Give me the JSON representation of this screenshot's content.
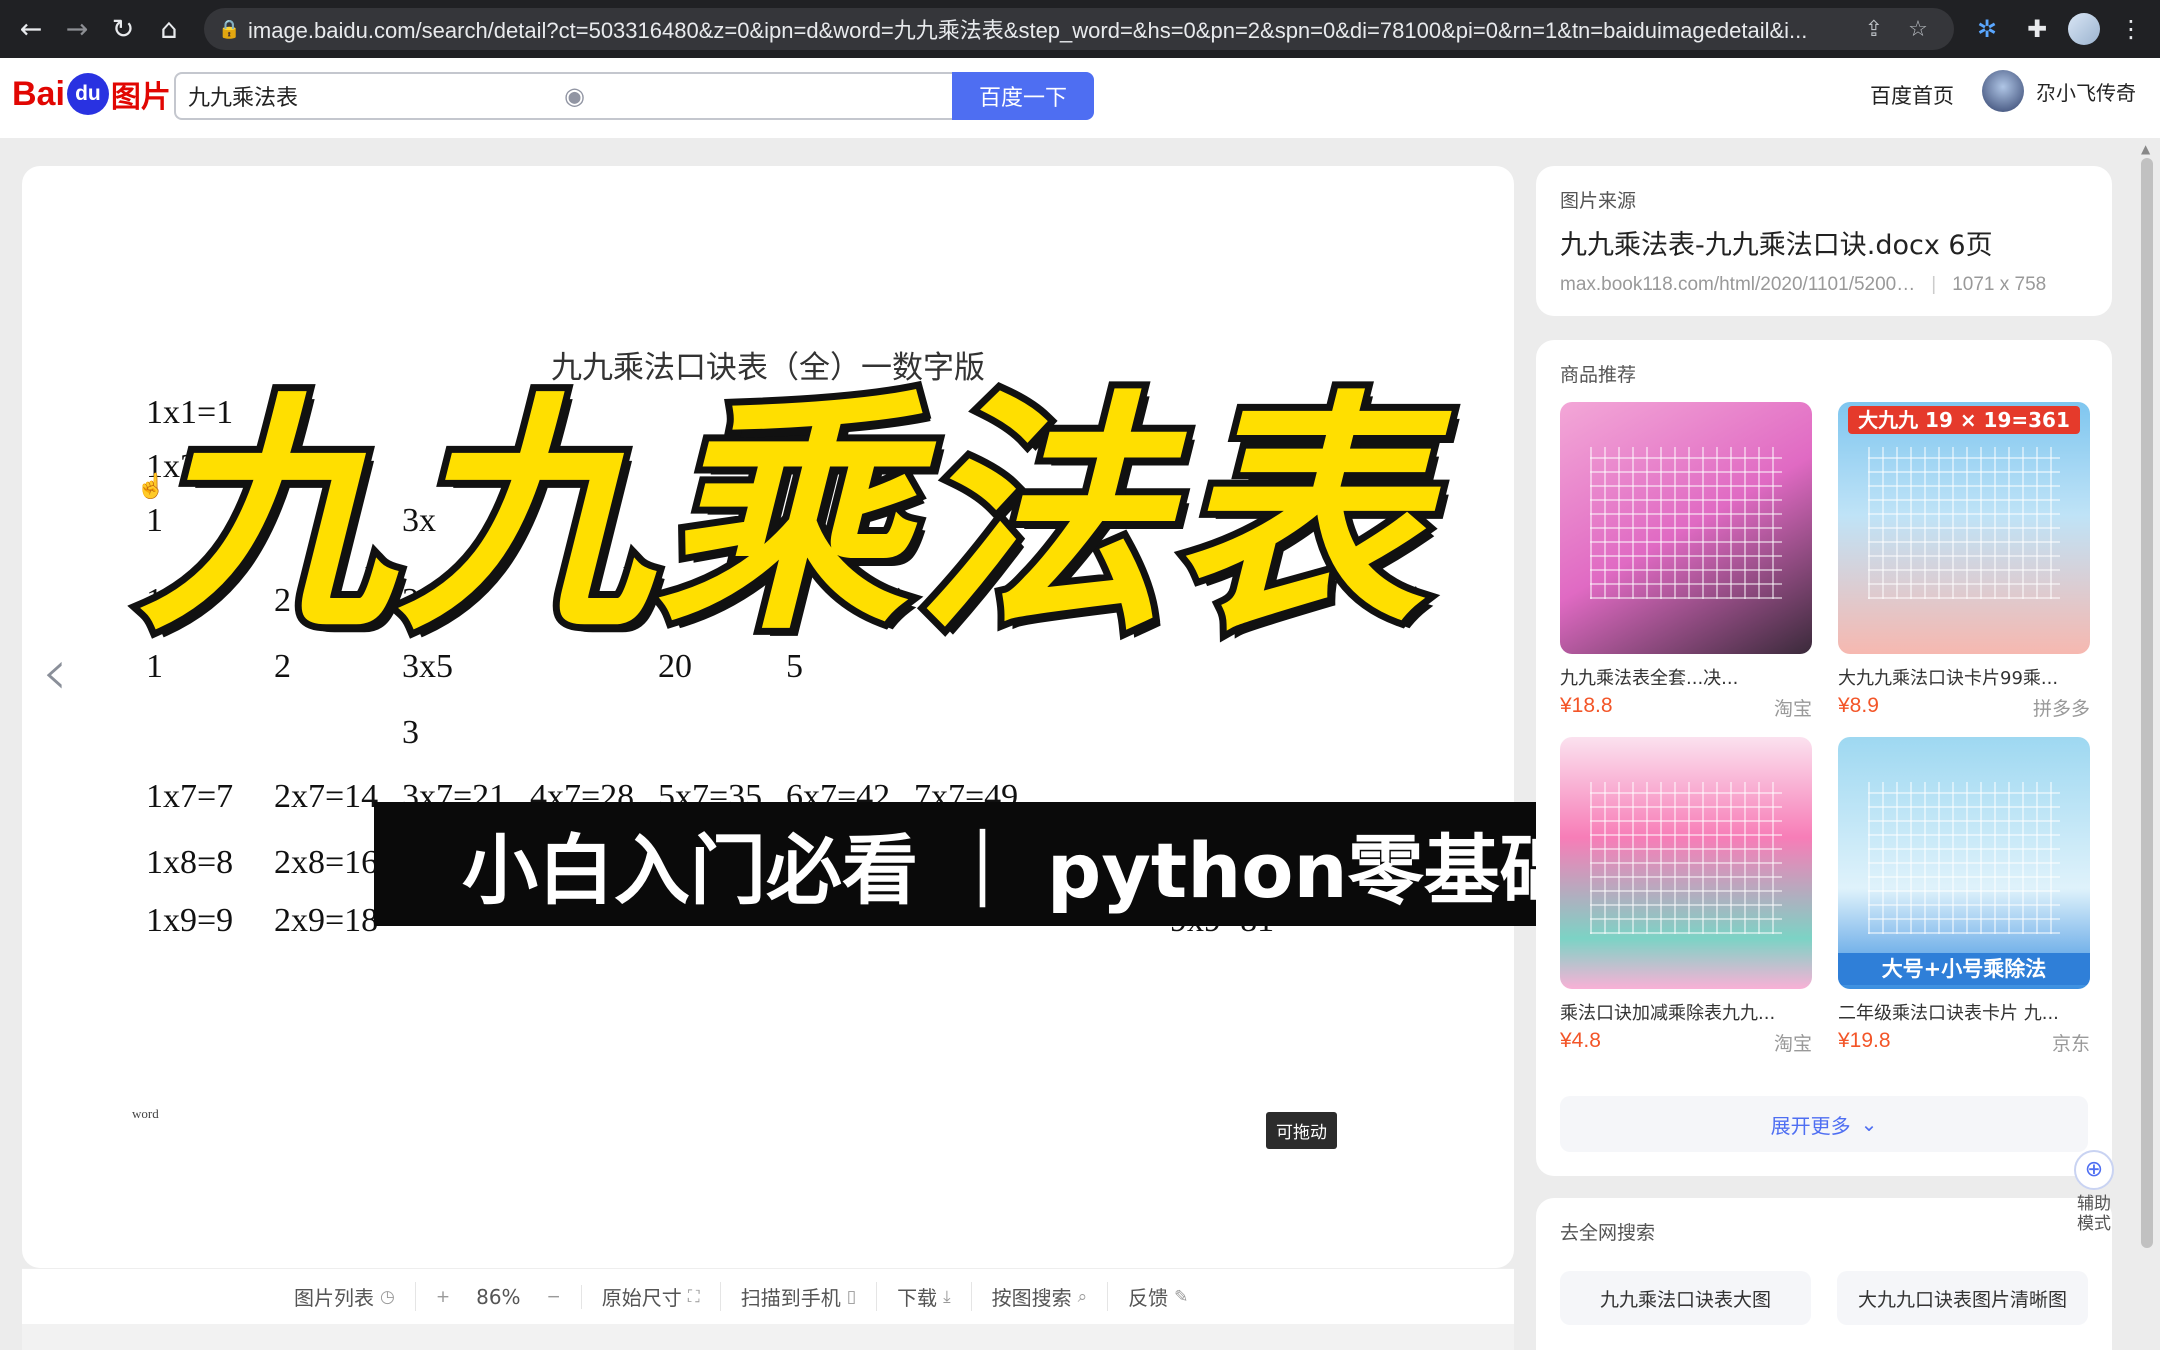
{
  "browser": {
    "url": "image.baidu.com/search/detail?ct=503316480&z=0&ipn=d&word=九九乘法表&step_word=&hs=0&pn=2&spn=0&di=78100&pi=0&rn=1&tn=baiduimagedetail&i..."
  },
  "header": {
    "logo_bai": "Bai",
    "logo_du": "du",
    "logo_pic": "图片",
    "search_value": "九九乘法表",
    "search_button": "百度一下",
    "home_link": "百度首页",
    "username": "尕小飞传奇"
  },
  "document": {
    "title": "九九乘法口诀表（全）一数字版",
    "rows": [
      [
        "1x1=1"
      ],
      [
        "1x2=2",
        "2x2=4"
      ],
      [
        "1",
        "",
        "3x"
      ],
      [
        "1x4",
        "2",
        "3x4="
      ],
      [
        "1",
        "2",
        "3x5",
        "",
        "20",
        "5"
      ],
      [
        "",
        "",
        "3"
      ],
      [
        "1x7=7",
        "2x7=14",
        "3x7=21",
        "4x7=28",
        "5x7=35",
        "6x7=42",
        "7x7=49"
      ],
      [
        "1x8=8",
        "2x8=16"
      ],
      [
        "1x9=9",
        "2x9=18",
        "",
        "",
        "",
        "",
        "",
        "",
        "9x9=81"
      ]
    ],
    "footer_mark": "word",
    "drag_tag": "可拖动"
  },
  "overlay": {
    "main_title": "九九乘法表 |",
    "subtitle": "小白入门必看 ｜ python零基础到全栈系列课程"
  },
  "toolbar": {
    "list": "图片列表",
    "zoom_plus": "+",
    "zoom": "86%",
    "zoom_minus": "−",
    "original": "原始尺寸",
    "scan": "扫描到手机",
    "download": "下载",
    "image_search": "按图搜索",
    "feedback": "反馈"
  },
  "source": {
    "label": "图片来源",
    "title": "九九乘法表-九九乘法口诀.docx 6页",
    "url": "max.book118.com/html/2020/1101/5200…",
    "dims": "1071 x 758"
  },
  "products": {
    "label": "商品推荐",
    "items": [
      {
        "name": "九九乘法表全套...决...",
        "price": "¥18.8",
        "shop": "淘宝",
        "img_text": ""
      },
      {
        "name": "大九九乘法口诀卡片99乘...",
        "price": "¥8.9",
        "shop": "拼多多",
        "img_text": "大九九 19 × 19=361"
      },
      {
        "name": "乘法口诀加减乘除表九九...",
        "price": "¥4.8",
        "shop": "淘宝",
        "img_text": ""
      },
      {
        "name": "二年级乘法口诀表卡片 九...",
        "price": "¥19.8",
        "shop": "京东",
        "img_text": "大号+小号乘除法"
      }
    ],
    "more": "展开更多"
  },
  "web_search": {
    "label": "去全网搜索",
    "tags": [
      "九九乘法口诀表大图",
      "大九九口诀表图片清晰图"
    ]
  },
  "assist": {
    "label": "辅助模式"
  }
}
